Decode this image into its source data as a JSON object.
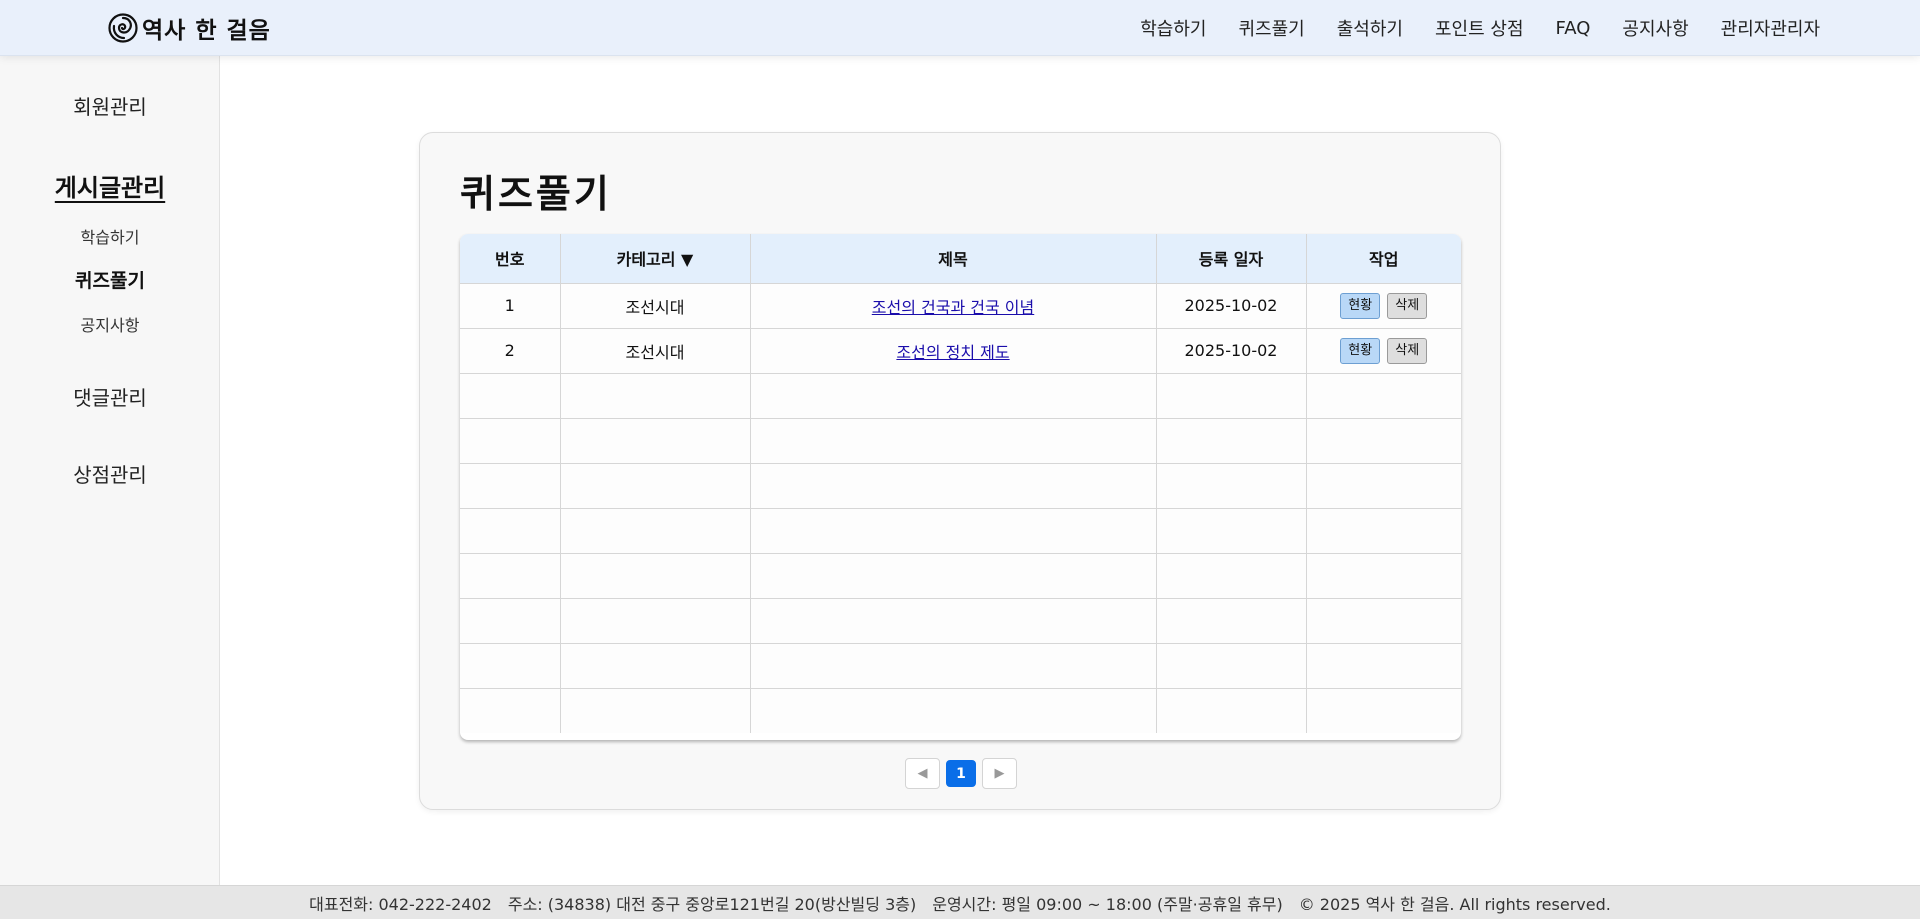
{
  "header": {
    "logo_text": "역사 한 걸음",
    "nav": [
      "학습하기",
      "퀴즈풀기",
      "출석하기",
      "포인트 상점",
      "FAQ",
      "공지사항",
      "관리자관리자"
    ]
  },
  "sidebar": {
    "member": "회원관리",
    "posts": "게시글관리",
    "sub": [
      "학습하기",
      "퀴즈풀기",
      "공지사항"
    ],
    "comments": "댓글관리",
    "shop": "상점관리"
  },
  "page": {
    "title": "퀴즈풀기"
  },
  "table": {
    "headers": {
      "no": "번호",
      "category": "카테고리 ▼",
      "title": "제목",
      "date": "등록 일자",
      "action": "작업"
    },
    "rows": [
      {
        "no": "1",
        "category": "조선시대",
        "title": "조선의 건국과 건국 이념",
        "date": "2025-10-02"
      },
      {
        "no": "2",
        "category": "조선시대",
        "title": "조선의 정치 제도",
        "date": "2025-10-02"
      }
    ],
    "status_label": "현황",
    "delete_label": "삭제"
  },
  "pagination": {
    "prev": "◀",
    "current": "1",
    "next": "▶"
  },
  "footer": {
    "phone": "대표전화: 042-222-2402",
    "address": "주소: (34838) 대전 중구 중앙로121번길 20(방산빌딩 3층)",
    "hours": "운영시간: 평일 09:00 ~ 18:00 (주말·공휴일 휴무)",
    "copyright": "© 2025 역사 한 걸음. All rights reserved."
  }
}
